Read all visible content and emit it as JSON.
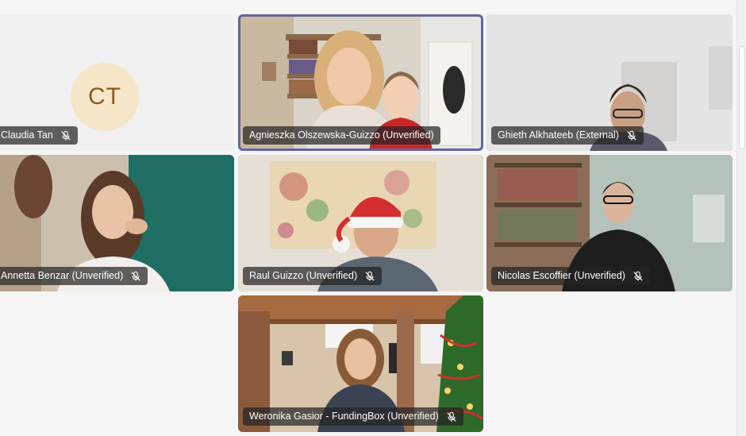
{
  "participants": [
    {
      "name": "Claudia Tan",
      "initials": "CT",
      "muted": true,
      "video": false
    },
    {
      "name": "Agnieszka Olszewska-Guizzo (Unverified)",
      "muted": false,
      "video": true,
      "speaking": true
    },
    {
      "name": "Ghieth Alkhateeb (External)",
      "muted": true,
      "video": true
    },
    {
      "name": "Annetta Benzar (Unverified)",
      "muted": true,
      "video": true
    },
    {
      "name": "Raul Guizzo (Unverified)",
      "muted": true,
      "video": true
    },
    {
      "name": "Nicolas Escoffier (Unverified)",
      "muted": true,
      "video": true
    },
    {
      "name": "Weronika Gasior - FundingBox (Unverified)",
      "muted": true,
      "video": true
    }
  ],
  "colors": {
    "speaking_border": "#6264a7",
    "avatar_bg": "#f6e6c8",
    "avatar_text": "#8a5a1f",
    "nametag_bg": "rgba(36,36,36,0.72)"
  },
  "icons": {
    "muted": "mic-off-icon"
  }
}
